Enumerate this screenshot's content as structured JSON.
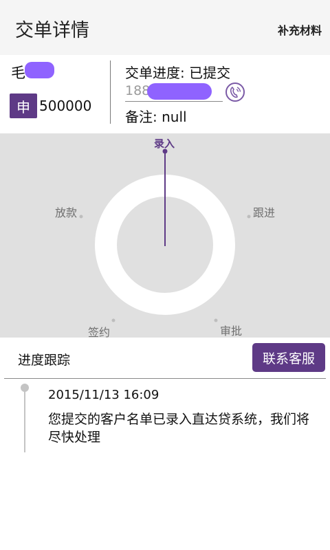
{
  "topbar": {
    "title": "交单详情",
    "action_label": "补充材料"
  },
  "applicant": {
    "surname": "毛",
    "type_badge": "申",
    "amount": "500000"
  },
  "order": {
    "progress_text": "交单进度: 已提交",
    "phone_prefix": "188",
    "remark_text": "备注: null"
  },
  "dial": {
    "stages": [
      "录入",
      "跟进",
      "审批",
      "签约",
      "放款"
    ],
    "active_stage": "录入",
    "accent_color": "#5e3a86"
  },
  "tracking": {
    "title": "进度跟踪",
    "contact_button": "联系客服",
    "entries": [
      {
        "time": "2015/11/13 16:09",
        "text": "您提交的客户名单已录入直达贷系统，我们将尽快处理"
      }
    ]
  }
}
